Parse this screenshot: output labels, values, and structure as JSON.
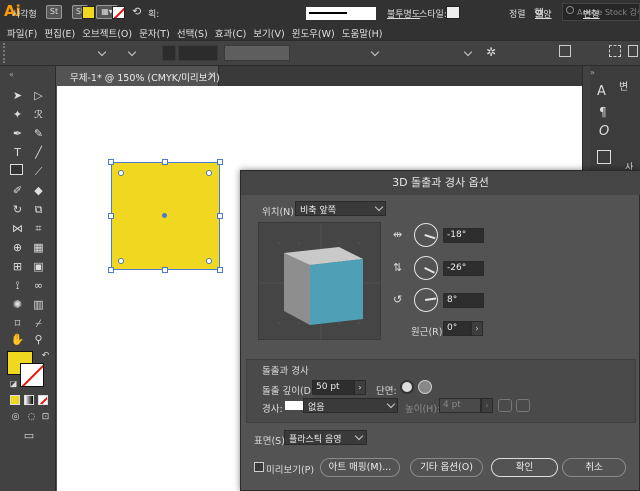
{
  "app": {
    "logo": "Ai",
    "top_icons": [
      "St",
      "▦▾",
      "⟲"
    ],
    "workspace_label": "헬",
    "search_placeholder": "Adobe Stock 검색"
  },
  "menu": [
    "파일(F)",
    "편집(E)",
    "오브젝트(O)",
    "문자(T)",
    "선택(S)",
    "효과(C)",
    "보기(V)",
    "윈도우(W)",
    "도움말(H)"
  ],
  "control_bar": {
    "label": "사각형",
    "stroke_label": "획:",
    "stroke_style": "기본",
    "opacity_label": "불투명도",
    "style_label": "스타일:",
    "right_items": [
      "정렬",
      "모양",
      "변형"
    ],
    "fill_color": "#f0d720"
  },
  "document": {
    "tab_label": "무제-1* @ 150% (CMYK/미리보기)",
    "tab_close": "×"
  },
  "right_panel": {
    "labels": [
      "변",
      "사각"
    ]
  },
  "dialog": {
    "title": "3D 돌출과 경사 옵션",
    "position_label": "위치(N):",
    "position_value": "비축 앞쪽",
    "rotation_x": "-18°",
    "rotation_y": "-26°",
    "rotation_z": "8°",
    "perspective_label": "원근(R):",
    "perspective_value": "0°",
    "extrude_section": "돌출과 경사",
    "extrude_depth_label": "돌출 깊이(D):",
    "extrude_depth_value": "50 pt",
    "cap_label": "단면:",
    "bevel_label": "경사:",
    "bevel_value": "없음",
    "height_label": "높이(H):",
    "height_value": "4 pt",
    "surface_label": "표면(S):",
    "surface_value": "플라스틱 음영",
    "preview_label": "미리보기(P)",
    "buttons": {
      "map_art": "아트 매핑(M)...",
      "more_options": "기타 옵션(O)",
      "ok": "확인",
      "cancel": "취소"
    }
  }
}
